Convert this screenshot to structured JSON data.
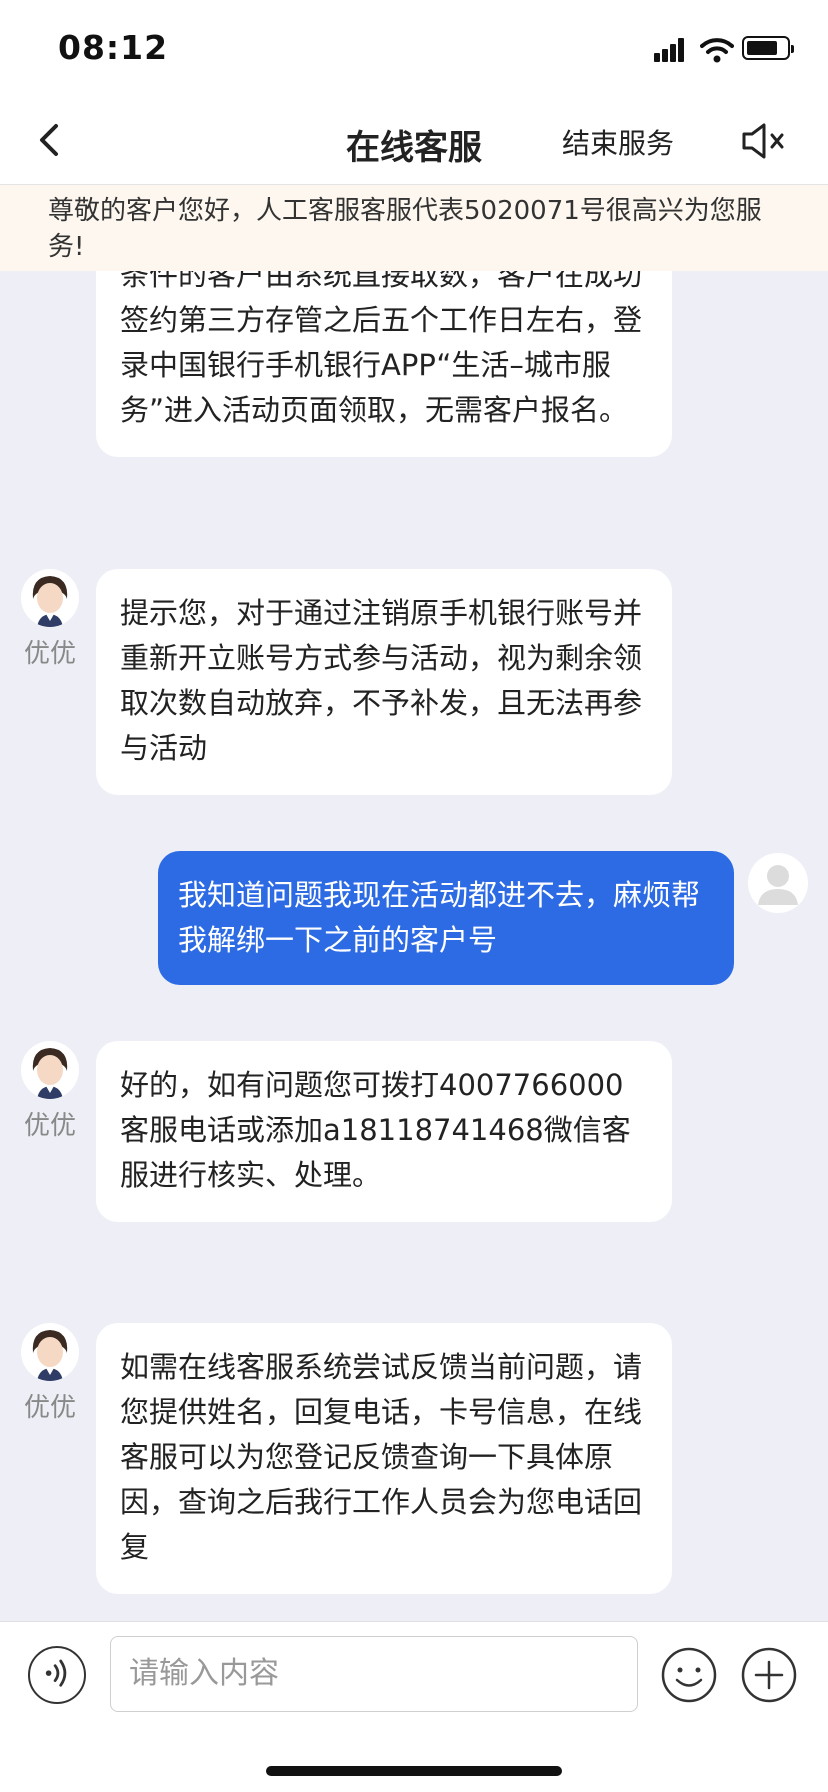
{
  "status_bar": {
    "time": "08:12",
    "icons": [
      "signal-icon",
      "wifi-icon",
      "battery-icon"
    ]
  },
  "header": {
    "title": "在线客服",
    "end_service": "结束服务",
    "icons": [
      "back-icon",
      "mute-icon"
    ]
  },
  "notice": "尊敬的客户您好，人工客服客服代表5020071号很高兴为您服务!",
  "messages": [
    {
      "from": "agent",
      "text": "条件的客户由系统直接取数，客户在成功签约第三方存管之后五个工作日左右，登录中国银行手机银行APP“生活–城市服务”进入活动页面领取，无需客户报名。"
    },
    {
      "from": "agent",
      "name": "优优",
      "text": "提示您，对于通过注销原手机银行账号并重新开立账号方式参与活动，视为剩余领取次数自动放弃，不予补发，且无法再参与活动"
    },
    {
      "from": "user",
      "text": "我知道问题我现在活动都进不去，麻烦帮我解绑一下之前的客户号"
    },
    {
      "from": "agent",
      "name": "优优",
      "text": "好的，如有问题您可拨打4007766000客服电话或添加a18118741468微信客服进行核实、处理。"
    },
    {
      "from": "agent",
      "name": "优优",
      "text": "如需在线客服系统尝试反馈当前问题，请您提供姓名，回复电话，卡号信息，在线客服可以为您登记反馈查询一下具体原因，查询之后我行工作人员会为您电话回复"
    }
  ],
  "input_bar": {
    "placeholder": "请输入内容",
    "icons": [
      "voice-icon",
      "emoji-icon",
      "plus-icon"
    ]
  },
  "colors": {
    "user_bubble": "#2d6be5",
    "background": "#eeeff6",
    "notice_bg": "#fdf7ef"
  }
}
